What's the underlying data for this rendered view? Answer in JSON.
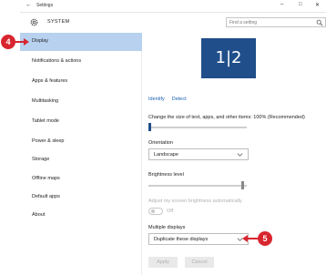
{
  "window": {
    "title": "Settings",
    "back_glyph": "←",
    "min_glyph": "–",
    "max_glyph": "□",
    "close_glyph": "✕"
  },
  "header": {
    "title": "SYSTEM",
    "search_placeholder": "Find a setting"
  },
  "sidebar": {
    "items": [
      {
        "label": "Display",
        "active": true
      },
      {
        "label": "Notifications & actions"
      },
      {
        "label": "Apps & features"
      },
      {
        "label": "Multitasking"
      },
      {
        "label": "Tablet mode"
      },
      {
        "label": "Power & sleep"
      },
      {
        "label": "Storage"
      },
      {
        "label": "Offline maps"
      },
      {
        "label": "Default apps"
      },
      {
        "label": "About"
      }
    ]
  },
  "main": {
    "monitor_label": "1|2",
    "identify_link": "Identify",
    "detect_link": "Detect",
    "scale_label": "Change the size of text, apps, and other items: 100% (Recommended)",
    "scale_value_percent": 100,
    "orientation_label": "Orientation",
    "orientation_value": "Landscape",
    "brightness_label": "Brightness level",
    "brightness_level_fraction": 0.97,
    "auto_brightness_label": "Adjust my screen brightness automatically",
    "auto_brightness_state": "Off",
    "multiple_displays_label": "Multiple displays",
    "multiple_displays_value": "Duplicate these displays",
    "apply_label": "Apply",
    "cancel_label": "Cancel"
  },
  "callouts": {
    "step_display": "4",
    "step_multiple": "5",
    "color": "#d8262f"
  },
  "colors": {
    "accent": "#1f4e8a",
    "selection": "#b7d1ef",
    "link": "#1a5fb4"
  }
}
